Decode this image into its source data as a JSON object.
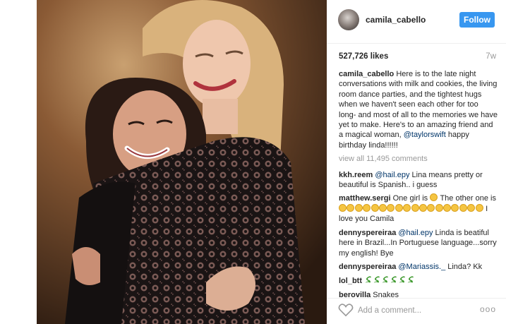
{
  "post": {
    "username": "camila_cabello",
    "follow_label": "Follow",
    "likes": "527,726 likes",
    "time": "7w",
    "caption": {
      "username": "camila_cabello",
      "text": " Here is to the late night conversations with milk and cookies, the living room dance parties, and the tightest hugs when we haven't seen each other for too long- and most of all to the memories we have yet to make. Here's to an amazing friend and a magical woman, ",
      "mention": "@taylorswift",
      "text_after": " happy birthday linda!!!!!!"
    },
    "view_all": "view all 11,495 comments"
  },
  "comments": [
    {
      "username": "kkh.reem",
      "mention": "@hail.epy",
      "text": " Lina means pretty or beautiful is Spanish.. i guess"
    },
    {
      "username": "matthew.sergi",
      "text_before": " One girl is ",
      "text_middle": " The other one is",
      "text_after": " I love you Camila",
      "emoji_count": 17
    },
    {
      "username": "dennyspereiraa",
      "mention": "@hail.epy",
      "text": " Linda is beatiful here in Brazil...In Portuguese language...sorry my english! Bye"
    },
    {
      "username": "dennyspereiraa",
      "mention": "@Mariassis._",
      "text": " Linda? Kk"
    },
    {
      "username": "lol_btt",
      "emoji": "snake",
      "emoji_count": 6
    },
    {
      "username": "berovilla",
      "text": " Snakes"
    }
  ],
  "footer": {
    "add_comment_placeholder": "Add a comment...",
    "more_label": "ooo"
  },
  "icons": {
    "heart": "heart-outline-icon",
    "more": "more-options-icon",
    "emoji": "heart-eyes-emoji-icon",
    "snake": "snake-emoji-icon"
  },
  "colors": {
    "follow_button": "#3897f0",
    "mention": "#003569",
    "muted": "#999999"
  }
}
